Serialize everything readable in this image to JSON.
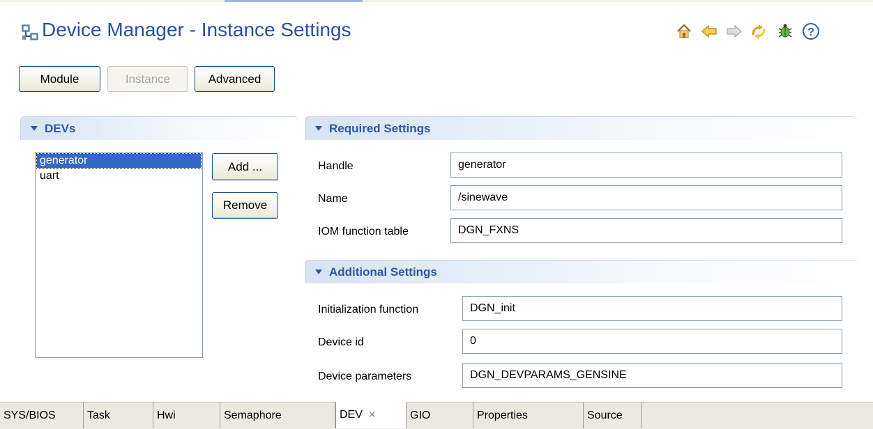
{
  "header": {
    "title": "Device Manager - Instance Settings",
    "title_icon": "device-manager-icon",
    "toolbar": [
      {
        "name": "home-icon",
        "color": "#c98a1f"
      },
      {
        "name": "back-arrow-icon",
        "color": "#e3b53a"
      },
      {
        "name": "forward-arrow-icon",
        "color": "#c8c8c8"
      },
      {
        "name": "refresh-icon",
        "color": "#e6a22c"
      },
      {
        "name": "bug-icon",
        "color": "#3d8a2e"
      },
      {
        "name": "help-icon",
        "color": "#2b5fa5"
      }
    ]
  },
  "buttons": {
    "module": "Module",
    "instance": "Instance",
    "advanced": "Advanced"
  },
  "devs_section": {
    "title": "DEVs",
    "items": [
      "generator",
      "uart"
    ],
    "selected": "generator",
    "add_label": "Add ...",
    "remove_label": "Remove"
  },
  "required": {
    "title": "Required Settings",
    "handle": {
      "label": "Handle",
      "value": "generator"
    },
    "name": {
      "label": "Name",
      "value": "/sinewave"
    },
    "iom": {
      "label": "IOM function table",
      "value": "DGN_FXNS"
    }
  },
  "additional": {
    "title": "Additional Settings",
    "init": {
      "label": "Initialization function",
      "value": "DGN_init"
    },
    "device_id": {
      "label": "Device id",
      "value": "0"
    },
    "params": {
      "label": "Device parameters",
      "value": "DGN_DEVPARAMS_GENSINE"
    }
  },
  "tabs": [
    {
      "label": "SYS/BIOS"
    },
    {
      "label": "Task"
    },
    {
      "label": "Hwi"
    },
    {
      "label": "Semaphore"
    },
    {
      "label": "DEV",
      "active": true
    },
    {
      "label": "GIO"
    },
    {
      "label": "Properties"
    },
    {
      "label": "Source"
    }
  ],
  "colors": {
    "title": "#2a4f9f",
    "section_title": "#2a59a6",
    "selection": "#316ac5"
  }
}
